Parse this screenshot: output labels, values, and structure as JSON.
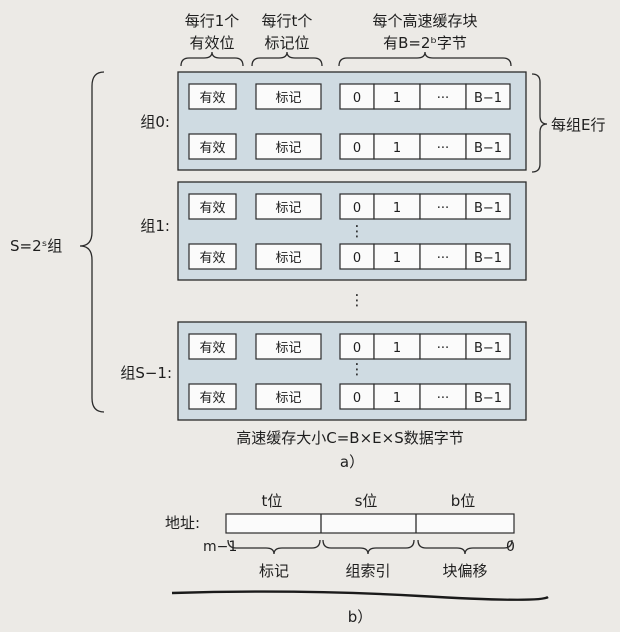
{
  "header": {
    "valid_caption_1": "每行1个",
    "valid_caption_2": "有效位",
    "tag_caption_1": "每行t个",
    "tag_caption_2": "标记位",
    "block_caption_1": "每个高速缓存块",
    "block_caption_2": "有B=2ᵇ字节"
  },
  "cells": {
    "valid": "有效",
    "tag": "标记",
    "b0": "0",
    "b1": "1",
    "ellipsis": "···",
    "blast": "B−1"
  },
  "labels": {
    "set0": "组0:",
    "set1": "组1:",
    "setS": "组S−1:",
    "sets_total": "S=2ˢ组",
    "lines_per_set": "每组E行",
    "vdots": "⋮",
    "cache_size": "高速缓存大小C=B×E×S数据字节",
    "caption_a": "a）"
  },
  "address": {
    "label": "地址:",
    "t_bits": "t位",
    "s_bits": "s位",
    "b_bits": "b位",
    "msb": "m−1",
    "lsb": "0",
    "tag_field": "标记",
    "set_index_field": "组索引",
    "block_offset_field": "块偏移",
    "caption_b": "b）"
  }
}
